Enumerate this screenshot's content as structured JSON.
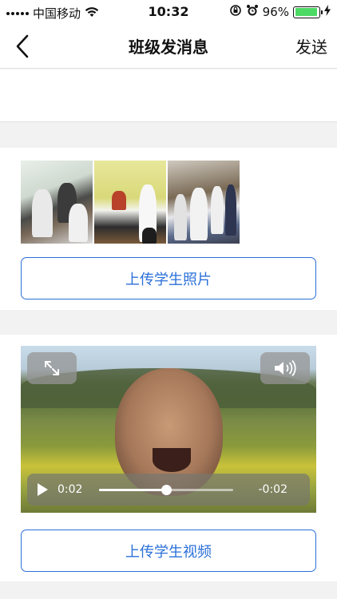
{
  "status_bar": {
    "carrier": "中国移动",
    "time": "10:32",
    "battery_percent": "96%",
    "battery_level": 0.96,
    "icons": [
      "signal-icon",
      "wifi-icon",
      "orientation-lock-icon",
      "alarm-icon",
      "battery-icon",
      "charging-icon"
    ]
  },
  "nav": {
    "title": "班级发消息",
    "send_label": "发送",
    "back_icon": "chevron-left-icon"
  },
  "message": {
    "placeholder": "",
    "value": ""
  },
  "photos": {
    "items": [
      "photo-1",
      "photo-2",
      "photo-3"
    ],
    "upload_label": "上传学生照片"
  },
  "video": {
    "current_time": "0:02",
    "remaining_time": "-0:02",
    "progress": 0.5,
    "upload_label": "上传学生视频"
  },
  "colors": {
    "accent": "#2a6fd8",
    "battery": "#4cd964",
    "section_gap": "#f2f2f2"
  }
}
